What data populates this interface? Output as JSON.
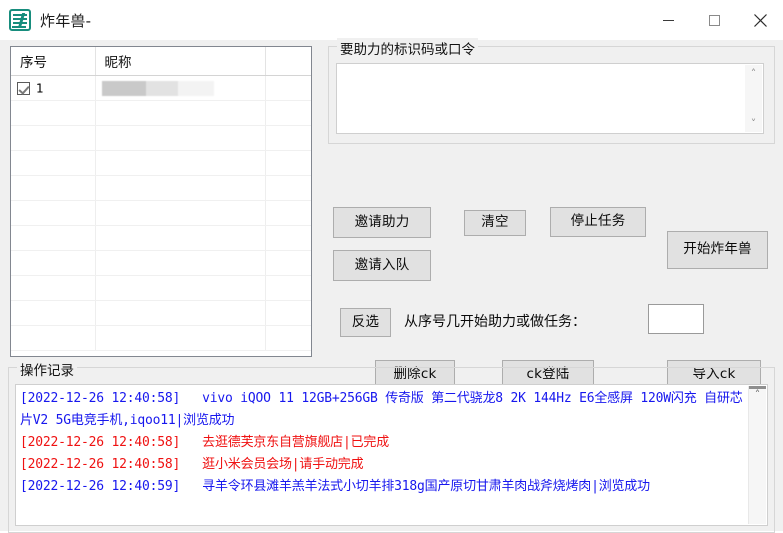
{
  "window": {
    "title": "炸年兽-",
    "icon": "app-icon",
    "minimize_label": "—",
    "maximize_label": "☐",
    "close_label": "✕"
  },
  "grid": {
    "columns": [
      "序号",
      "昵称",
      ""
    ],
    "rows": [
      {
        "checked": true,
        "index": "1",
        "nickname": "",
        "redacted": true
      },
      {
        "checked": false,
        "index": "",
        "nickname": "",
        "redacted": false
      },
      {
        "checked": false,
        "index": "",
        "nickname": "",
        "redacted": false
      },
      {
        "checked": false,
        "index": "",
        "nickname": "",
        "redacted": false
      },
      {
        "checked": false,
        "index": "",
        "nickname": "",
        "redacted": false
      },
      {
        "checked": false,
        "index": "",
        "nickname": "",
        "redacted": false
      },
      {
        "checked": false,
        "index": "",
        "nickname": "",
        "redacted": false
      },
      {
        "checked": false,
        "index": "",
        "nickname": "",
        "redacted": false
      },
      {
        "checked": false,
        "index": "",
        "nickname": "",
        "redacted": false
      },
      {
        "checked": false,
        "index": "",
        "nickname": "",
        "redacted": false
      },
      {
        "checked": false,
        "index": "",
        "nickname": "",
        "redacted": false
      }
    ]
  },
  "code_group": {
    "title": "要助力的标识码或口令",
    "value": "",
    "scroll_up": "˄",
    "scroll_down": "˅"
  },
  "buttons": {
    "invite_help": "邀请助力",
    "clear": "清空",
    "stop_task": "停止任务",
    "invite_team": "邀请入队",
    "start": "开始炸年兽",
    "invert_select": "反选",
    "delete_ck": "删除ck",
    "ck_login": "ck登陆",
    "import_ck": "导入ck"
  },
  "start_index": {
    "label": "从序号几开始助力或做任务：",
    "value": "",
    "placeholder": ""
  },
  "log_group": {
    "title": "操作记录",
    "scroll_up": "˄",
    "lines": [
      {
        "color": "blue",
        "timestamp": "[2022-12-26 12:40:58]",
        "text": "vivo iQOO 11 12GB+256GB 传奇版 第二代骁龙8 2K 144Hz E6全感屏 120W闪充 自研芯片V2 5G电竞手机,iqoo11|浏览成功"
      },
      {
        "color": "red",
        "timestamp": "[2022-12-26 12:40:58]",
        "text": "去逛德芙京东自营旗舰店|已完成"
      },
      {
        "color": "red",
        "timestamp": "[2022-12-26 12:40:58]",
        "text": "逛小米会员会场|请手动完成"
      },
      {
        "color": "blue",
        "timestamp": "[2022-12-26 12:40:59]",
        "text": "寻羊令环县滩羊羔羊法式小切羊排318g国产原切甘肃羊肉战斧烧烤肉|浏览成功"
      }
    ]
  },
  "colors": {
    "window_bg": "#f0f0f0",
    "log_blue": "#1717ee",
    "log_red": "#ef1111",
    "icon_teal": "#178d7d",
    "button_face": "#e1e1e1"
  }
}
